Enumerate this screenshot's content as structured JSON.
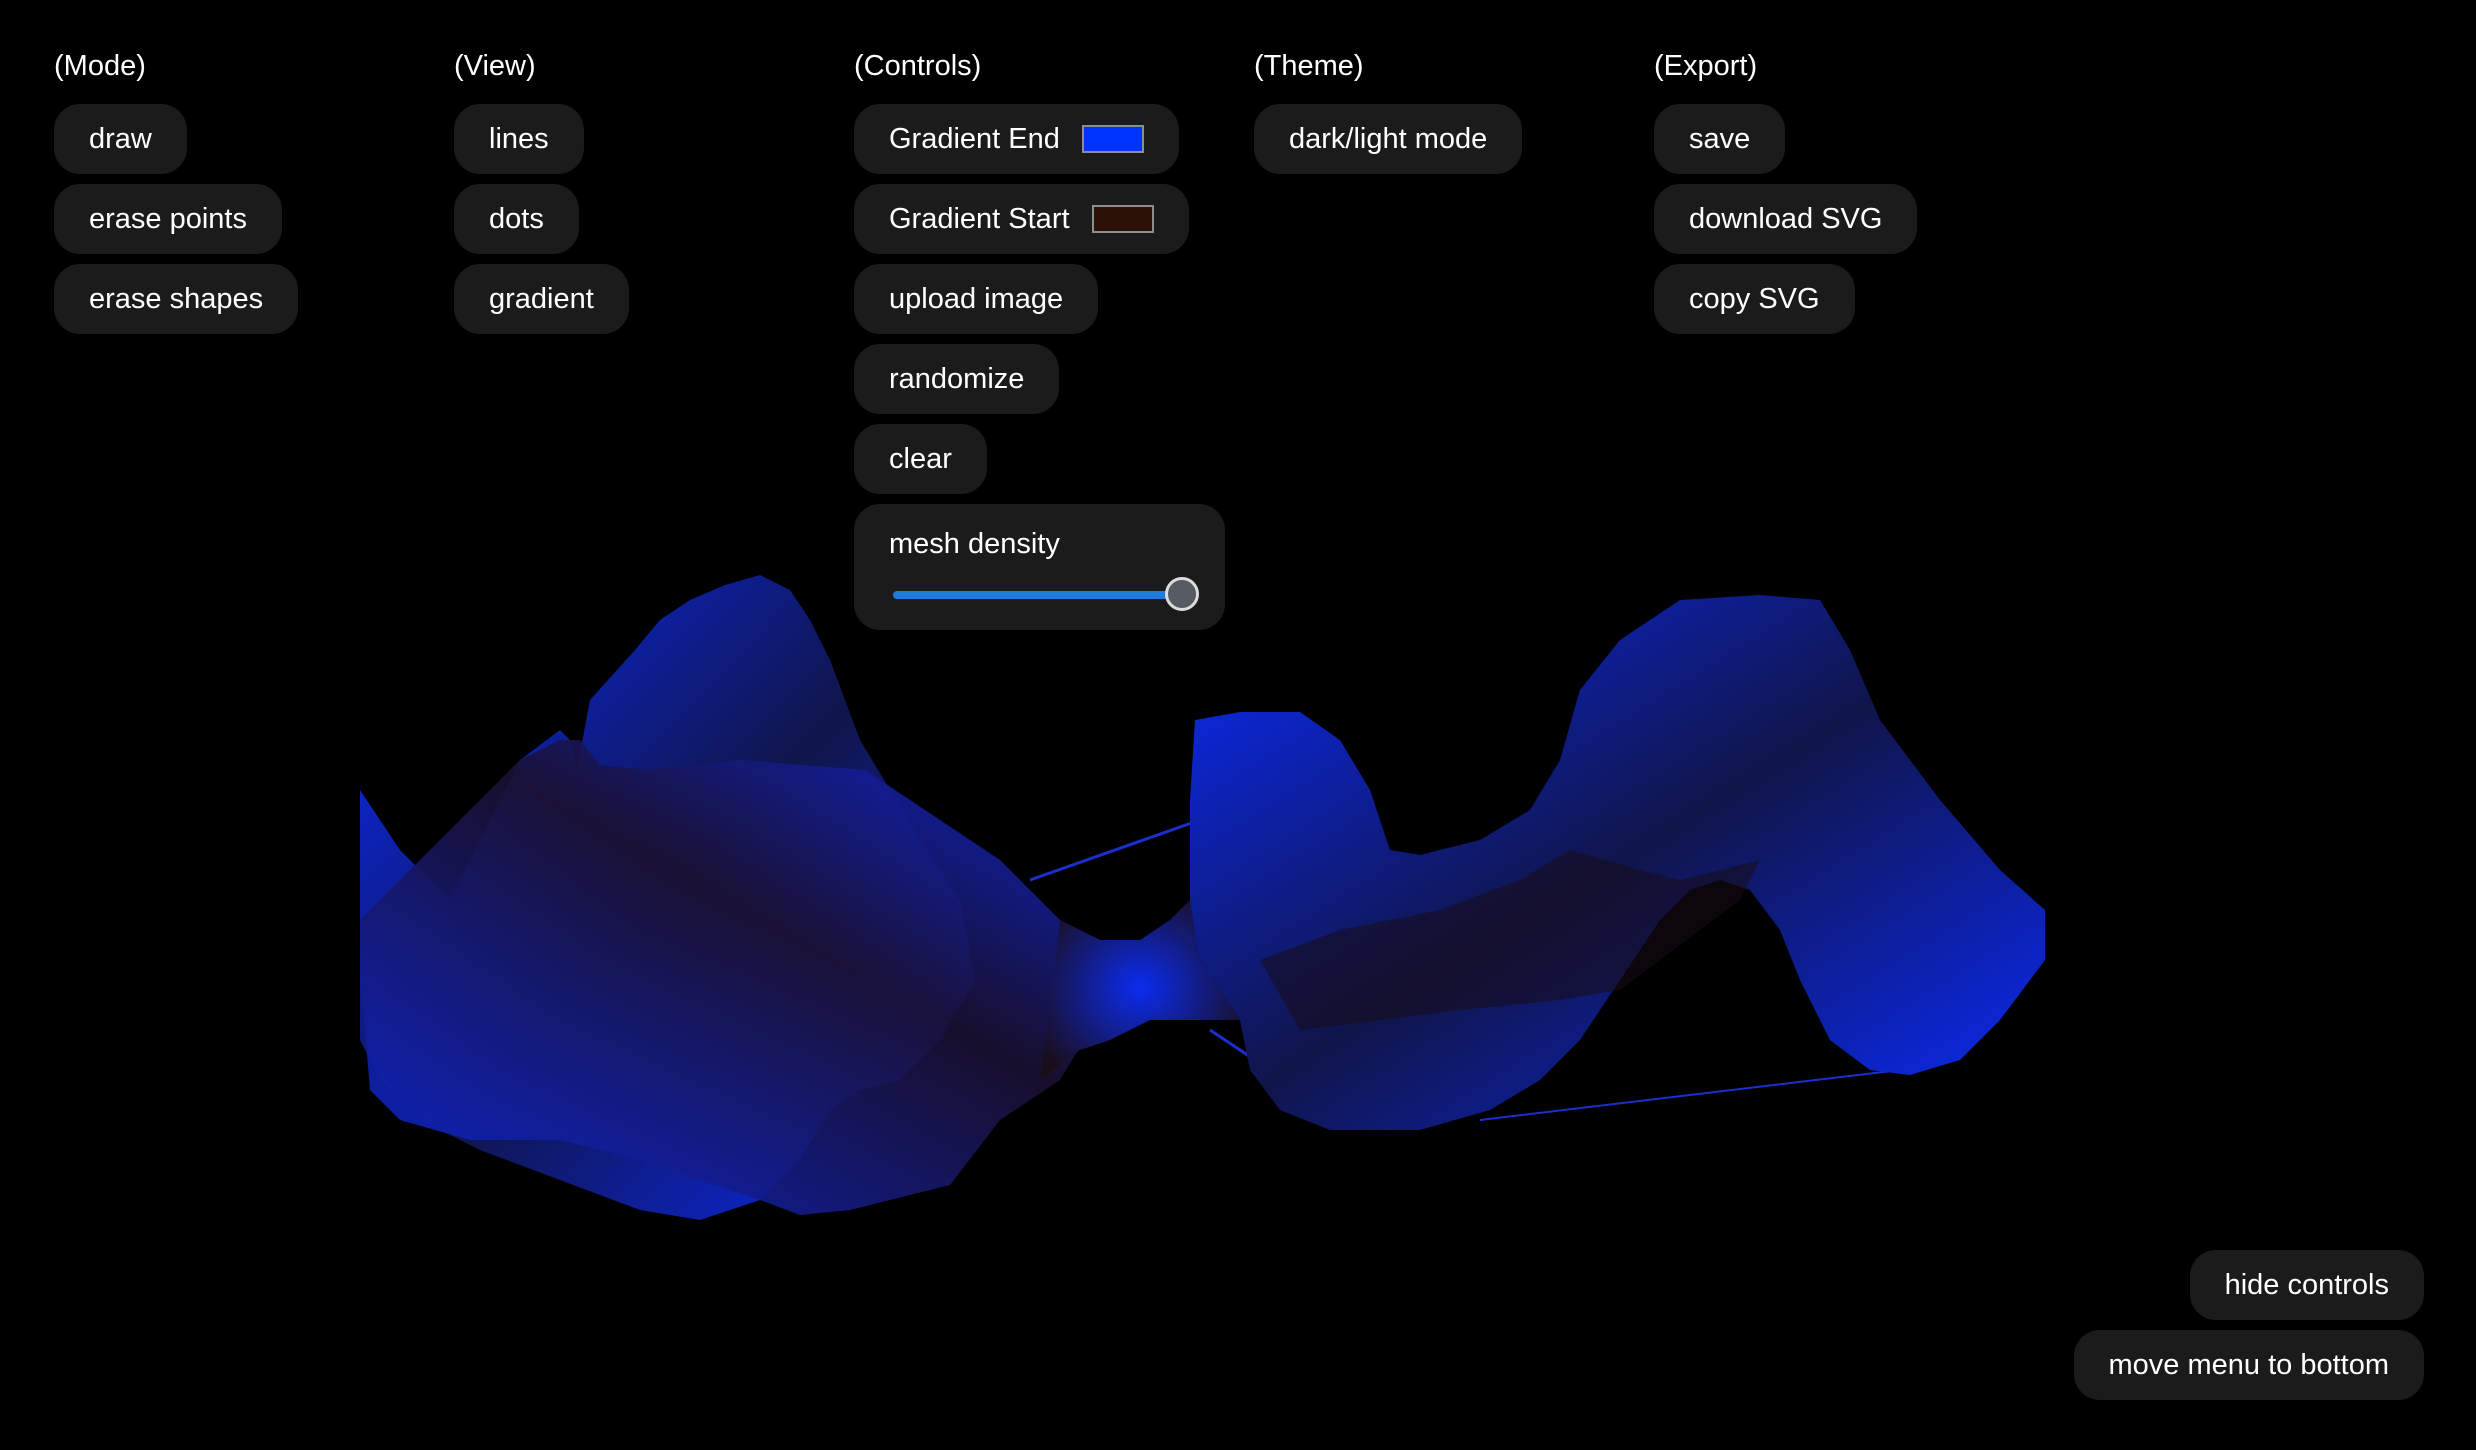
{
  "columns": {
    "mode": {
      "heading": "(Mode)",
      "buttons": [
        "draw",
        "erase points",
        "erase shapes"
      ]
    },
    "view": {
      "heading": "(View)",
      "buttons": [
        "lines",
        "dots",
        "gradient"
      ]
    },
    "controls": {
      "heading": "(Controls)",
      "gradient_end": {
        "label": "Gradient End",
        "color": "#0033ff"
      },
      "gradient_start": {
        "label": "Gradient Start",
        "color": "#2a1208"
      },
      "buttons": [
        "upload image",
        "randomize",
        "clear"
      ],
      "mesh_density": {
        "label": "mesh density",
        "value": 1.0
      }
    },
    "theme": {
      "heading": "(Theme)",
      "buttons": [
        "dark/light mode"
      ]
    },
    "export": {
      "heading": "(Export)",
      "buttons": [
        "save",
        "download SVG",
        "copy SVG"
      ]
    }
  },
  "footer": {
    "hide_controls": "hide controls",
    "move_menu": "move menu to bottom"
  },
  "colors": {
    "background": "#000000",
    "button_bg": "#1b1b1b",
    "accent": "#1f7ae0",
    "mesh_end": "#0a2bff",
    "mesh_start": "#2a1208"
  }
}
